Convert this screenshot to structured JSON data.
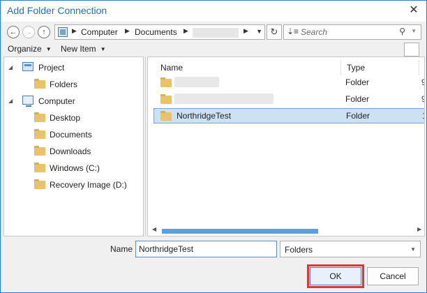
{
  "window": {
    "title": "Add Folder Connection",
    "close_glyph": "✕"
  },
  "nav": {
    "back_icon": "arrow-left-icon",
    "forward_icon": "arrow-right-icon",
    "up_icon": "arrow-up-icon",
    "breadcrumbs": [
      "Computer",
      "Documents"
    ],
    "search_placeholder": "Search"
  },
  "toolbar": {
    "organize_label": "Organize",
    "new_item_label": "New Item"
  },
  "tree": {
    "items": [
      {
        "label": "Project",
        "icon": "project-icon",
        "expanded": true
      },
      {
        "label": "Folders",
        "icon": "folder-icon"
      },
      {
        "label": "Computer",
        "icon": "computer-icon",
        "expanded": true
      },
      {
        "label": "Desktop",
        "icon": "folder-icon"
      },
      {
        "label": "Documents",
        "icon": "folder-icon"
      },
      {
        "label": "Downloads",
        "icon": "folder-icon"
      },
      {
        "label": "Windows (C:)",
        "icon": "folder-icon"
      },
      {
        "label": "Recovery Image (D:)",
        "icon": "folder-icon"
      }
    ]
  },
  "list": {
    "columns": [
      "Name",
      "Type"
    ],
    "rows": [
      {
        "name": "",
        "type": "Folder",
        "blurred": true
      },
      {
        "name": "",
        "type": "Folder",
        "blurred": true
      },
      {
        "name": "NorthridgeTest",
        "type": "Folder",
        "selected": true
      }
    ]
  },
  "bottom": {
    "name_label": "Name",
    "name_value": "NorthridgeTest",
    "type_filter": "Folders",
    "ok_label": "OK",
    "cancel_label": "Cancel"
  },
  "colors": {
    "title": "#1e73be",
    "selection": "#cce1f2",
    "highlight": "#d9383a"
  }
}
